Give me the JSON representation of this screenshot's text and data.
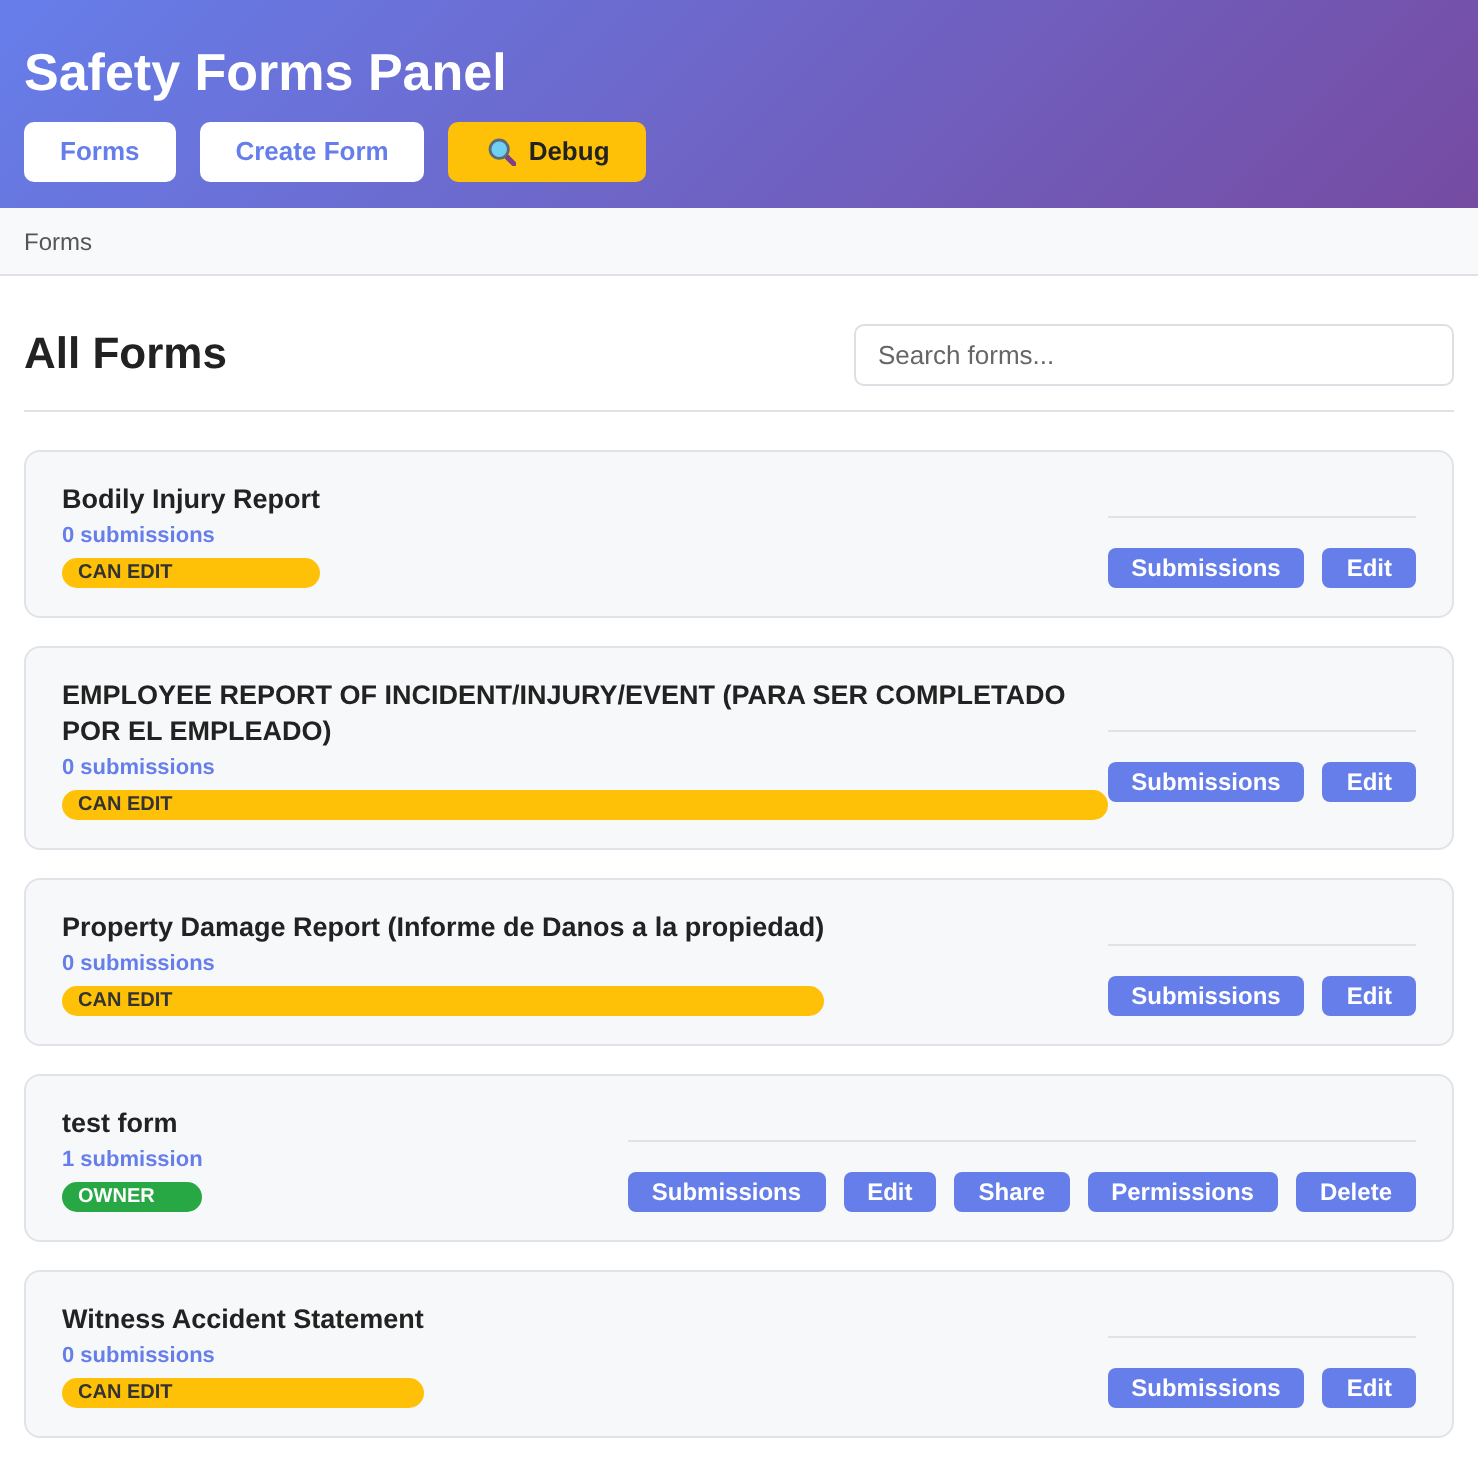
{
  "header": {
    "title": "Safety Forms Panel",
    "buttons": [
      {
        "label": "Forms",
        "kind": "nav"
      },
      {
        "label": "Create Form",
        "kind": "nav"
      },
      {
        "label": "Debug",
        "kind": "debug"
      }
    ]
  },
  "breadcrumb": [
    "Forms"
  ],
  "heading": "All Forms",
  "search": {
    "placeholder": "Search forms..."
  },
  "forms": [
    {
      "title": "Bodily Injury Report",
      "submissions": "0 submissions",
      "role": {
        "label": "CAN EDIT",
        "kind": "editor"
      },
      "actions": [
        "Submissions",
        "Edit"
      ]
    },
    {
      "title": "EMPLOYEE REPORT OF INCIDENT/INJURY/EVENT (PARA SER COMPLETADO POR EL EMPLEADO)",
      "submissions": "0 submissions",
      "role": {
        "label": "CAN EDIT",
        "kind": "editor"
      },
      "actions": [
        "Submissions",
        "Edit"
      ]
    },
    {
      "title": "Property Damage Report (Informe de Danos a la propiedad)",
      "submissions": "0 submissions",
      "role": {
        "label": "CAN EDIT",
        "kind": "editor"
      },
      "actions": [
        "Submissions",
        "Edit"
      ]
    },
    {
      "title": "test form",
      "submissions": "1 submission",
      "role": {
        "label": "OWNER",
        "kind": "owner"
      },
      "actions": [
        "Submissions",
        "Edit",
        "Share",
        "Permissions",
        "Delete"
      ]
    },
    {
      "title": "Witness Accident Statement",
      "submissions": "0 submissions",
      "role": {
        "label": "CAN EDIT",
        "kind": "editor"
      },
      "actions": [
        "Submissions",
        "Edit"
      ]
    }
  ]
}
